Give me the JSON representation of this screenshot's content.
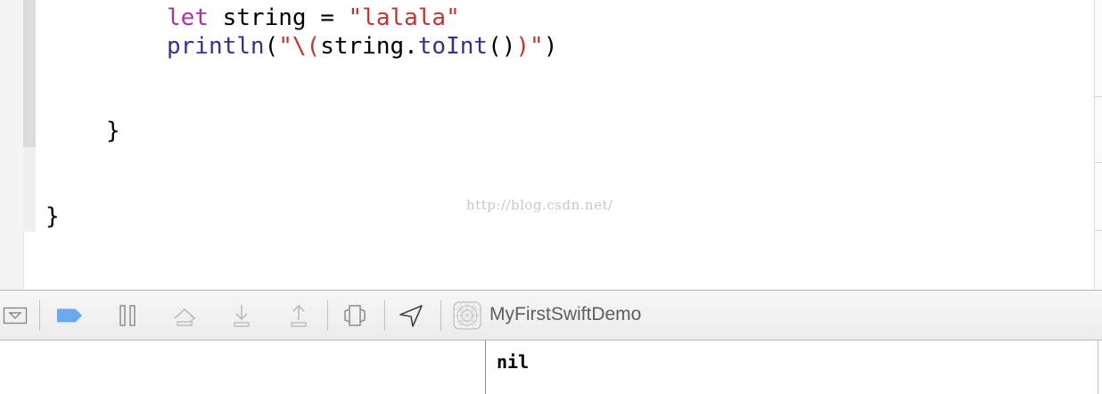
{
  "editor": {
    "line1": {
      "keyword": "let",
      "name": " string = ",
      "literal": "\"lalala\""
    },
    "line2": {
      "fn": "println",
      "p1": "(",
      "q1": "\"\\",
      "interp_open": "(",
      "ident": "string.",
      "method": "toInt",
      "call": "()",
      "interp_close": ")",
      "q2": "\"",
      "p2": ")"
    },
    "brace_inner": "}",
    "brace_outer": "}",
    "watermark": "http://blog.csdn.net/"
  },
  "debug_bar": {
    "target_name": "MyFirstSwiftDemo",
    "buttons": [
      "hide-debug-area-icon",
      "breakpoints-icon",
      "pause-icon",
      "step-over-icon",
      "step-into-icon",
      "step-out-icon",
      "debug-view-hierarchy-icon",
      "simulate-location-icon",
      "app-target-icon"
    ]
  },
  "console": {
    "output": "nil"
  },
  "colors": {
    "keyword": "#b22fa5",
    "string": "#c4342a",
    "function": "#3e2c8f",
    "breakpoint_blue": "#6aa8f0"
  }
}
